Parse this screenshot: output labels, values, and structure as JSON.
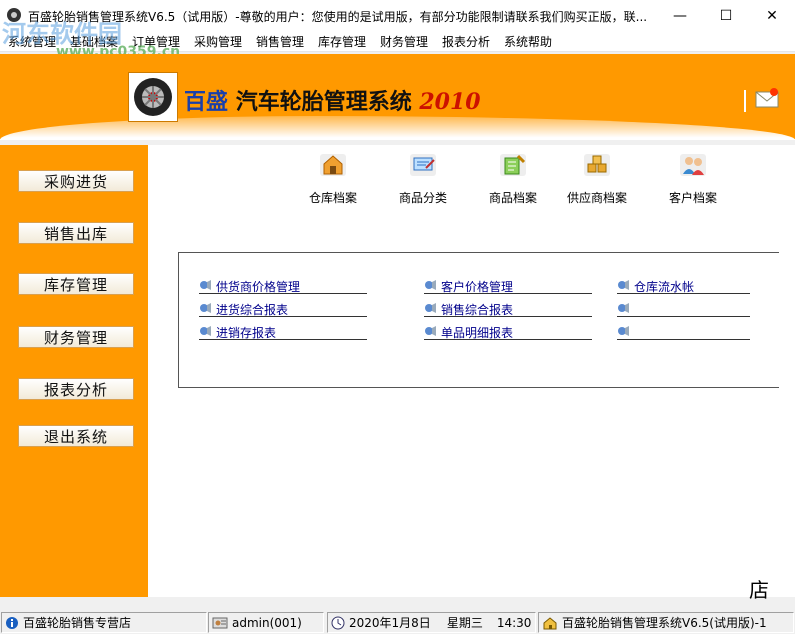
{
  "window": {
    "title": "百盛轮胎销售管理系统V6.5（试用版）-尊敬的用户：您使用的是试用版，有部分功能限制请联系我们购买正版，联...",
    "minimize_glyph": "—",
    "maximize_glyph": "☐",
    "close_glyph": "✕"
  },
  "watermark": {
    "logo": "河东软件园",
    "url": "www.pc0359.cn"
  },
  "menu": [
    "系统管理",
    "基础档案",
    "订单管理",
    "采购管理",
    "销售管理",
    "库存管理",
    "财务管理",
    "报表分析",
    "系统帮助"
  ],
  "header": {
    "brand_name": "百盛",
    "system_name": "汽车轮胎管理系统",
    "year": "2010"
  },
  "toolbar": [
    {
      "label": "仓库档案",
      "icon": "warehouse-icon"
    },
    {
      "label": "商品分类",
      "icon": "category-icon"
    },
    {
      "label": "商品档案",
      "icon": "product-icon"
    },
    {
      "label": "供应商档案",
      "icon": "supplier-icon"
    },
    {
      "label": "客户档案",
      "icon": "customer-icon"
    }
  ],
  "sidebar": [
    "采购进货",
    "销售出库",
    "库存管理",
    "财务管理",
    "报表分析",
    "退出系统"
  ],
  "links": [
    [
      "供货商价格管理",
      "客户价格管理",
      "仓库流水帐"
    ],
    [
      "进货综合报表",
      "销售综合报表",
      ""
    ],
    [
      "进销存报表",
      "单品明细报表",
      ""
    ]
  ],
  "corner_text": "店",
  "status": {
    "shop": "百盛轮胎销售专营店",
    "user": "admin(001)",
    "date": "2020年1月8日",
    "weekday": "星期三",
    "time": "14:30",
    "app": "百盛轮胎销售管理系统V6.5(试用版)-1"
  },
  "colors": {
    "accent": "#ff9900",
    "link": "#00008b"
  }
}
